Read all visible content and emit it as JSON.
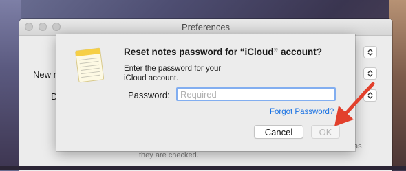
{
  "window": {
    "title": "Preferences",
    "labels": {
      "new": "New n",
      "d": "D"
    },
    "description_fragment": "they are checked.",
    "right_fragment": "as"
  },
  "dialog": {
    "title": "Reset notes password for “iCloud” account?",
    "message_line1": "Enter the password for your",
    "message_line2": "iCloud account.",
    "password_label": "Password:",
    "password_placeholder": "Required",
    "password_value": "",
    "forgot_link": "Forgot Password?",
    "cancel_label": "Cancel",
    "ok_label": "OK",
    "ok_enabled": false
  },
  "icons": {
    "app_icon": "notes-icon",
    "popup": "chevron-updown-icon",
    "annotation": "red-arrow-icon"
  },
  "colors": {
    "link": "#1a72e3",
    "focus_ring": "#82aef0",
    "arrow": "#e2402c",
    "notes_yellow": "#f6cf45"
  }
}
